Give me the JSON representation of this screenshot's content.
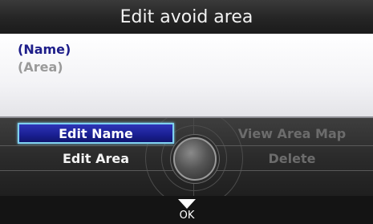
{
  "screen": {
    "title": "Edit avoid area"
  },
  "info": {
    "name": "(Name)",
    "area": "(Area)"
  },
  "menu": {
    "edit_name": "Edit Name",
    "edit_area": "Edit Area",
    "view_area_map": "View Area Map",
    "delete": "Delete",
    "selected": "Edit Name"
  },
  "footer": {
    "ok_label": "OK",
    "ok_icon": "down-arrow-icon"
  },
  "colors": {
    "highlight": "#1a1f92",
    "highlight_border": "#7fd0f0",
    "name_text": "#1e1e8a",
    "disabled_text": "#6c6c6c"
  }
}
